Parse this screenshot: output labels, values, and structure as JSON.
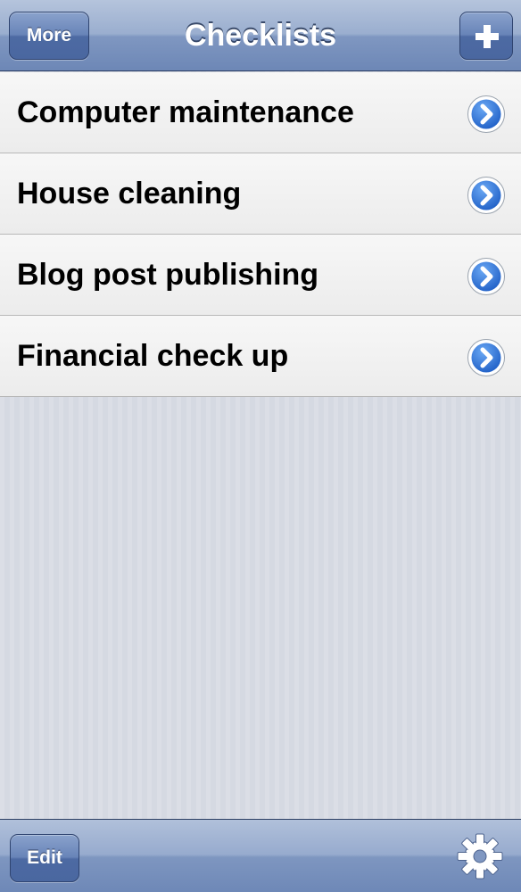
{
  "navbar": {
    "title": "Checklists",
    "left_button": "More",
    "right_button_icon": "plus-icon"
  },
  "checklists": [
    {
      "label": "Computer maintenance",
      "accessory_icon": "chevron-right-circle-icon"
    },
    {
      "label": "House cleaning",
      "accessory_icon": "chevron-right-circle-icon"
    },
    {
      "label": "Blog post publishing",
      "accessory_icon": "chevron-right-circle-icon"
    },
    {
      "label": "Financial check up",
      "accessory_icon": "chevron-right-circle-icon"
    }
  ],
  "toolbar": {
    "left_button": "Edit",
    "right_icon": "gear-icon"
  },
  "colors": {
    "bar_blue": "#7f97c1",
    "accent_blue": "#2f6fd6",
    "background": "#d5d9e2"
  }
}
